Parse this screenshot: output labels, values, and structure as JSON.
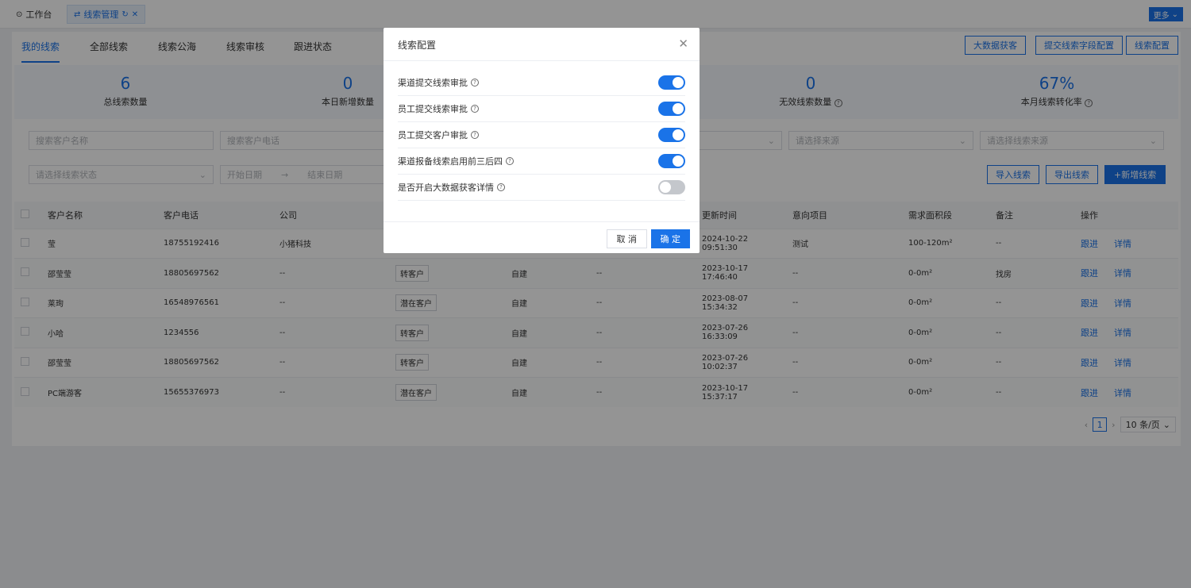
{
  "topbar": {
    "tabs": [
      {
        "label": "工作台",
        "icon": "dashboard-icon"
      },
      {
        "label": "线索管理",
        "icon": "hierarchy-icon"
      }
    ],
    "more_label": "更多"
  },
  "subtabs": [
    "我的线索",
    "全部线索",
    "线索公海",
    "线索审核",
    "跟进状态"
  ],
  "top_actions": [
    "大数据获客",
    "提交线索字段配置",
    "线索配置"
  ],
  "stats": [
    {
      "value": "6",
      "label": "总线索数量"
    },
    {
      "value": "0",
      "label": "本日新增数量"
    },
    {
      "value": "0",
      "label": "无效线索数量"
    },
    {
      "value": "67%",
      "label": "本月线索转化率"
    }
  ],
  "filters": {
    "customer_name": "搜索客户名称",
    "customer_phone": "搜索客户电话",
    "source": "请选择来源",
    "lead_source": "请选择线索来源",
    "status": "请选择线索状态",
    "start_date": "开始日期",
    "end_date": "结束日期"
  },
  "actions": {
    "import": "导入线索",
    "export": "导出线索",
    "add": "+新增线索"
  },
  "table": {
    "headers": [
      "客户名称",
      "客户电话",
      "公司",
      "更新时间",
      "意向项目",
      "需求面积段",
      "备注",
      "操作"
    ],
    "rows": [
      {
        "name": "莹",
        "phone": "18755192416",
        "company": "小猪科技",
        "tag": "",
        "source": "",
        "dash": "",
        "time": "2024-10-22 09:51:30",
        "project": "测试",
        "area": "100-120m²",
        "remark": "--"
      },
      {
        "name": "邵莹莹",
        "phone": "18805697562",
        "company": "--",
        "tag": "转客户",
        "source": "自建",
        "dash": "--",
        "time": "2023-10-17 17:46:40",
        "project": "--",
        "area": "0-0m²",
        "remark": "找房"
      },
      {
        "name": "莱珣",
        "phone": "16548976561",
        "company": "--",
        "tag": "潜在客户",
        "source": "自建",
        "dash": "--",
        "time": "2023-08-07 15:34:32",
        "project": "--",
        "area": "0-0m²",
        "remark": "--"
      },
      {
        "name": "小哈",
        "phone": "1234556",
        "company": "--",
        "tag": "转客户",
        "source": "自建",
        "dash": "--",
        "time": "2023-07-26 16:33:09",
        "project": "--",
        "area": "0-0m²",
        "remark": "--"
      },
      {
        "name": "邵莹莹",
        "phone": "18805697562",
        "company": "--",
        "tag": "转客户",
        "source": "自建",
        "dash": "--",
        "time": "2023-07-26 10:02:37",
        "project": "--",
        "area": "0-0m²",
        "remark": "--"
      },
      {
        "name": "PC端游客",
        "phone": "15655376973",
        "company": "--",
        "tag": "潜在客户",
        "source": "自建",
        "dash": "--",
        "time": "2023-10-17 15:37:17",
        "project": "--",
        "area": "0-0m²",
        "remark": "--"
      }
    ],
    "row_actions": [
      "跟进",
      "详情"
    ]
  },
  "pager": {
    "current": "1",
    "page_size": "10 条/页"
  },
  "modal": {
    "title": "线索配置",
    "options": [
      {
        "label": "渠道提交线索审批",
        "enabled": true
      },
      {
        "label": "员工提交线索审批",
        "enabled": true
      },
      {
        "label": "员工提交客户审批",
        "enabled": true
      },
      {
        "label": "渠道报备线索启用前三后四",
        "enabled": true
      },
      {
        "label": "是否开启大数据获客详情",
        "enabled": false
      }
    ],
    "cancel_label": "取 消",
    "ok_label": "确 定"
  }
}
